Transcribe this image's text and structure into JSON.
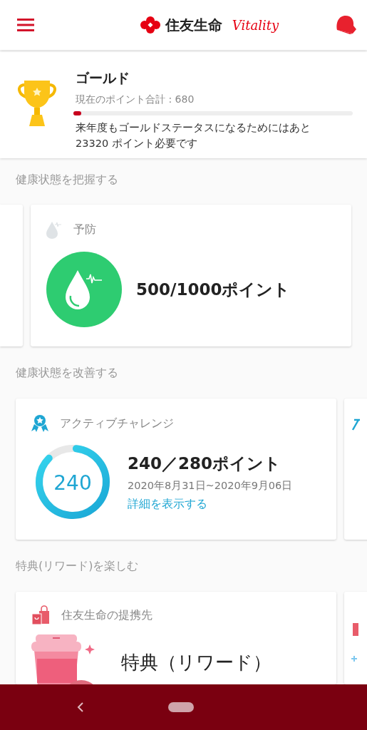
{
  "header": {
    "brand": "住友生命",
    "logo_script": "Vitality"
  },
  "status": {
    "tier": "ゴールド",
    "points_label": "現在のポイント合計 : 680",
    "level": 0.028,
    "message_lines": [
      "来年度もゴールドステータスになるためにはあと",
      "23320 ポイント必要です"
    ]
  },
  "sections": [
    {
      "title": "健康状態を把握する",
      "card": {
        "kind": "prevention",
        "label": "予防",
        "value": "500/1000ポイント"
      }
    },
    {
      "title": "健康状態を改善する",
      "card": {
        "kind": "challenge",
        "label": "アクティブチャレンジ",
        "ring_value": "240",
        "value": "240／280ポイント",
        "period": "2020年8月31日~2020年9月06日",
        "link": "詳細を表示する"
      }
    },
    {
      "title": "特典(リワード)を楽しむ",
      "card": {
        "kind": "rewards",
        "label": "住友生命の提携先",
        "value": "特典（リワード）"
      }
    }
  ]
}
